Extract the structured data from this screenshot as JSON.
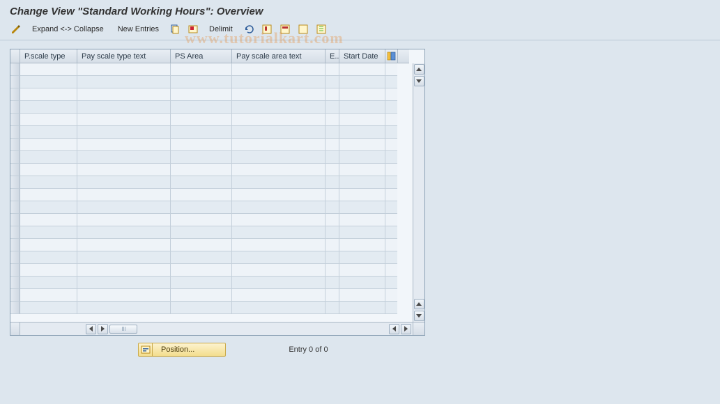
{
  "title": "Change View \"Standard Working Hours\": Overview",
  "watermark": "www.tutorialkart.com",
  "toolbar": {
    "expand_collapse": "Expand <-> Collapse",
    "new_entries": "New Entries",
    "delimit": "Delimit"
  },
  "columns": [
    {
      "id": "c1",
      "label": "P.scale type"
    },
    {
      "id": "c2",
      "label": "Pay scale type text"
    },
    {
      "id": "c3",
      "label": "PS Area"
    },
    {
      "id": "c4",
      "label": "Pay scale area text"
    },
    {
      "id": "c5",
      "label": "E.."
    },
    {
      "id": "c6",
      "label": "Start Date"
    }
  ],
  "row_count": 20,
  "footer": {
    "position_label": "Position...",
    "entry_status": "Entry 0 of 0"
  }
}
